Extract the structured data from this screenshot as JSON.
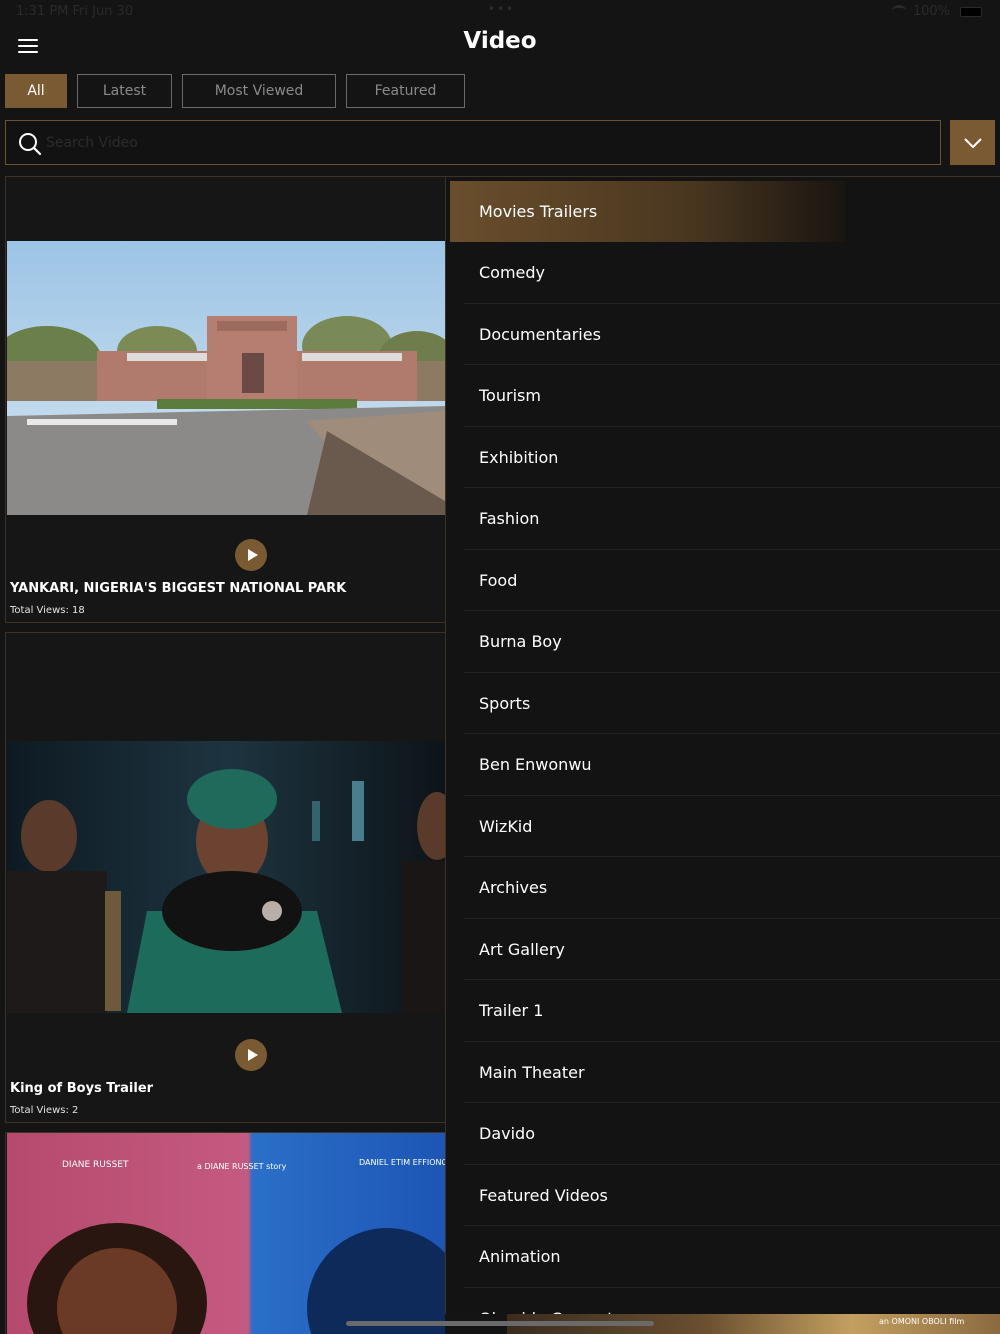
{
  "status_bar": {
    "time_date": "1:31 PM   Fri Jun 30",
    "dots": "•••",
    "battery": "100%"
  },
  "header": {
    "title": "Video"
  },
  "tabs": [
    {
      "label": "All",
      "active": true
    },
    {
      "label": "Latest",
      "active": false
    },
    {
      "label": "Most Viewed",
      "active": false
    },
    {
      "label": "Featured",
      "active": false
    }
  ],
  "search": {
    "placeholder": "Search Video",
    "value": ""
  },
  "videos": [
    {
      "title": "YANKARI, NIGERIA'S BIGGEST NATIONAL PARK",
      "views": "Total Views: 18"
    },
    {
      "title": "King of Boys Trailer",
      "views": "Total Views: 2"
    },
    {
      "title": "",
      "views": "",
      "poster_text_1": "DIANE RUSSET",
      "poster_text_2": "a DIANE RUSSET story",
      "poster_text_3": "DANIEL ETIM EFFIONG"
    }
  ],
  "categories": [
    "Movies Trailers",
    "Comedy",
    "Documentaries",
    "Tourism",
    "Exhibition",
    "Fashion",
    "Food",
    "Burna Boy",
    "Sports",
    "Ben Enwonwu",
    "WizKid",
    "Archives",
    "Art Gallery",
    "Trailer 1",
    "Main Theater",
    "Davido",
    "Featured Videos",
    "Animation",
    "Olamide Concert"
  ],
  "selected_category": "Movies Trailers",
  "bottom_strip_text": "an OMONI OBOLI film",
  "colors": {
    "accent": "#7a5a32",
    "background": "#141414",
    "text": "#ffffff"
  }
}
